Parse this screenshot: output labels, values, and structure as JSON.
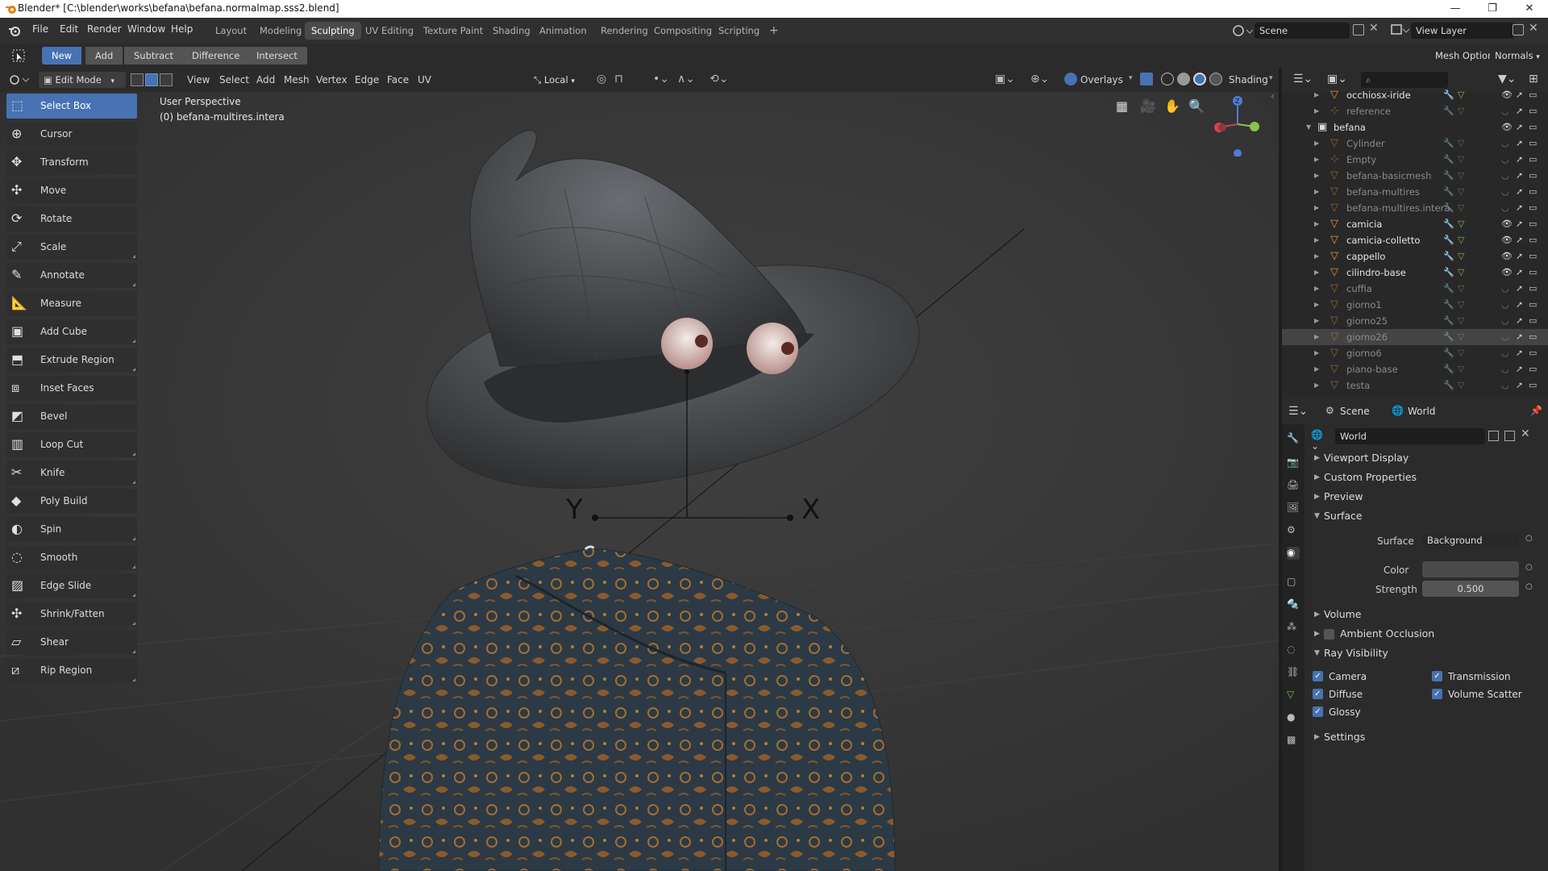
{
  "titlebar": {
    "title": "Blender* [C:\\blender\\works\\befana\\befana.normalmap.sss2.blend]",
    "minimize": "—",
    "maximize": "❐",
    "close": "✕"
  },
  "menu": {
    "items": [
      "File",
      "Edit",
      "Render",
      "Window",
      "Help"
    ]
  },
  "workspaces": {
    "tabs": [
      "Layout",
      "Modeling",
      "Sculpting",
      "UV Editing",
      "Texture Paint",
      "Shading",
      "Animation",
      "Rendering",
      "Compositing",
      "Scripting"
    ],
    "active": "Sculpting",
    "add": "+"
  },
  "scene": {
    "name": "Scene",
    "view_layer": "View Layer"
  },
  "toolheader": {
    "modes": [
      "New",
      "Add",
      "Subtract",
      "Difference",
      "Intersect"
    ],
    "active_mode": "New",
    "mesh_options": "Mesh Options",
    "normals": "Normals"
  },
  "viewport_header": {
    "mode": "Edit Mode",
    "menus": [
      "View",
      "Select",
      "Add",
      "Mesh",
      "Vertex",
      "Edge",
      "Face",
      "UV"
    ],
    "orientation": "Local",
    "overlays": "Overlays",
    "shading": "Shading"
  },
  "viewport": {
    "perspective": "User Perspective",
    "object": "(0) befana-multires.intera",
    "axis_y": "Y",
    "axis_x": "X"
  },
  "tools": [
    {
      "label": "Select Box",
      "icon": "select-box-icon",
      "active": true,
      "corner": false
    },
    {
      "label": "Cursor",
      "icon": "cursor-icon",
      "active": false,
      "corner": false
    },
    {
      "label": "Transform",
      "icon": "transform-icon",
      "active": false,
      "corner": false
    },
    {
      "label": "Move",
      "icon": "move-icon",
      "active": false,
      "corner": false
    },
    {
      "label": "Rotate",
      "icon": "rotate-icon",
      "active": false,
      "corner": false
    },
    {
      "label": "Scale",
      "icon": "scale-icon",
      "active": false,
      "corner": true
    },
    {
      "label": "Annotate",
      "icon": "annotate-icon",
      "active": false,
      "corner": true
    },
    {
      "label": "Measure",
      "icon": "measure-icon",
      "active": false,
      "corner": false
    },
    {
      "label": "Add Cube",
      "icon": "add-cube-icon",
      "active": false,
      "corner": true
    },
    {
      "label": "Extrude Region",
      "icon": "extrude-icon",
      "active": false,
      "corner": true
    },
    {
      "label": "Inset Faces",
      "icon": "inset-icon",
      "active": false,
      "corner": false
    },
    {
      "label": "Bevel",
      "icon": "bevel-icon",
      "active": false,
      "corner": false
    },
    {
      "label": "Loop Cut",
      "icon": "loop-cut-icon",
      "active": false,
      "corner": true
    },
    {
      "label": "Knife",
      "icon": "knife-icon",
      "active": false,
      "corner": true
    },
    {
      "label": "Poly Build",
      "icon": "poly-build-icon",
      "active": false,
      "corner": false
    },
    {
      "label": "Spin",
      "icon": "spin-icon",
      "active": false,
      "corner": true
    },
    {
      "label": "Smooth",
      "icon": "smooth-icon",
      "active": false,
      "corner": true
    },
    {
      "label": "Edge Slide",
      "icon": "edge-slide-icon",
      "active": false,
      "corner": true
    },
    {
      "label": "Shrink/Fatten",
      "icon": "shrink-fatten-icon",
      "active": false,
      "corner": true
    },
    {
      "label": "Shear",
      "icon": "shear-icon",
      "active": false,
      "corner": true
    },
    {
      "label": "Rip Region",
      "icon": "rip-region-icon",
      "active": false,
      "corner": true
    }
  ],
  "outliner": {
    "rows": [
      {
        "name": "occhiosx-iride",
        "type": "mesh",
        "bright": true,
        "visible": true,
        "collection": false
      },
      {
        "name": "reference",
        "type": "empty",
        "bright": false,
        "visible": false,
        "collection": false
      },
      {
        "name": "befana",
        "type": "collection",
        "bright": true,
        "visible": true,
        "collection": true
      },
      {
        "name": "Cylinder",
        "type": "mesh",
        "bright": false,
        "visible": false,
        "collection": false
      },
      {
        "name": "Empty",
        "type": "empty",
        "bright": false,
        "visible": false,
        "collection": false
      },
      {
        "name": "befana-basicmesh",
        "type": "mesh",
        "bright": false,
        "visible": false,
        "collection": false
      },
      {
        "name": "befana-multires",
        "type": "mesh",
        "bright": false,
        "visible": false,
        "collection": false
      },
      {
        "name": "befana-multires.intera",
        "type": "mesh",
        "bright": false,
        "visible": false,
        "collection": false
      },
      {
        "name": "camicia",
        "type": "mesh",
        "bright": true,
        "visible": true,
        "collection": false
      },
      {
        "name": "camicia-colletto",
        "type": "mesh",
        "bright": true,
        "visible": true,
        "collection": false
      },
      {
        "name": "cappello",
        "type": "mesh",
        "bright": true,
        "visible": true,
        "collection": false
      },
      {
        "name": "cilindro-base",
        "type": "mesh",
        "bright": true,
        "visible": true,
        "collection": false
      },
      {
        "name": "cuffia",
        "type": "mesh",
        "bright": false,
        "visible": false,
        "collection": false
      },
      {
        "name": "giorno1",
        "type": "mesh",
        "bright": false,
        "visible": false,
        "collection": false
      },
      {
        "name": "giorno25",
        "type": "mesh",
        "bright": false,
        "visible": false,
        "collection": false
      },
      {
        "name": "giorno26",
        "type": "mesh",
        "bright": false,
        "visible": false,
        "collection": false,
        "selected": true
      },
      {
        "name": "giorno6",
        "type": "mesh",
        "bright": false,
        "visible": false,
        "collection": false
      },
      {
        "name": "piano-base",
        "type": "mesh",
        "bright": false,
        "visible": false,
        "collection": false
      },
      {
        "name": "testa",
        "type": "mesh",
        "bright": false,
        "visible": false,
        "collection": false
      }
    ]
  },
  "properties": {
    "tab_scene": "Scene",
    "tab_world": "World",
    "world_name": "World",
    "sections": {
      "viewport_display": "Viewport Display",
      "custom_properties": "Custom Properties",
      "preview": "Preview",
      "surface": "Surface",
      "volume": "Volume",
      "ambient_occlusion": "Ambient Occlusion",
      "ray_visibility": "Ray Visibility",
      "settings": "Settings"
    },
    "surface_label": "Surface",
    "surface_value": "Background",
    "color_label": "Color",
    "strength_label": "Strength",
    "strength_value": "0.500",
    "ray": {
      "camera": "Camera",
      "diffuse": "Diffuse",
      "glossy": "Glossy",
      "transmission": "Transmission",
      "volume_scatter": "Volume Scatter"
    }
  },
  "colors": {
    "accent": "#4772b3",
    "object_orange": "#e0933b",
    "mesh_green": "#7fbf5a"
  }
}
